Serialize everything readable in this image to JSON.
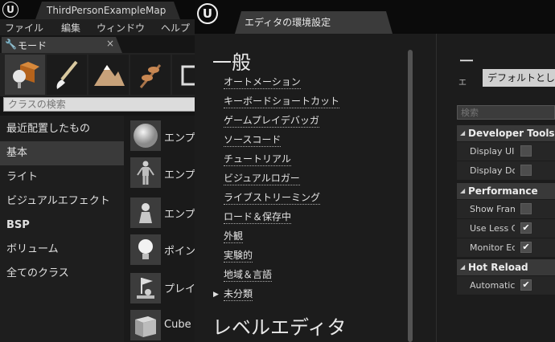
{
  "main_window": {
    "map_tab_title": "ThirdPersonExampleMap",
    "menu": [
      "ファイル",
      "編集",
      "ウィンドウ",
      "ヘルプ"
    ]
  },
  "modes_panel": {
    "tab_label": "モード",
    "close_symbol": "×",
    "mode_icons": [
      "place-mode-icon",
      "paint-mode-icon",
      "landscape-mode-icon",
      "foliage-mode-icon",
      "geometry-mode-icon"
    ],
    "search_placeholder": "クラスの検索",
    "categories": [
      "最近配置したもの",
      "基本",
      "ライト",
      "ビジュアルエフェクト",
      "BSP",
      "ボリューム",
      "全てのクラス"
    ],
    "selected_category": "基本",
    "assets": [
      "エンプ",
      "エンプ",
      "エンプ",
      "ポイン",
      "プレイ",
      "Cube"
    ]
  },
  "prefs_window": {
    "title": "エディタの環境設定",
    "general_header": "一般",
    "nav_links": [
      "オートメーション",
      "キーボードショートカット",
      "ゲームプレイデバッガ",
      "ソースコード",
      "チュートリアル",
      "ビジュアルロガー",
      "ライブストリーミング",
      "ロード＆保存中",
      "外観",
      "実験的",
      "地域＆言語",
      "未分類"
    ],
    "level_editor_header": "レベルエディタ",
    "details": {
      "heading": "ー",
      "preset_label": "エ",
      "preset_value": "デフォルトとし",
      "search_placeholder": "検索",
      "categories": [
        {
          "name": "Developer Tools",
          "props": [
            {
              "name": "Display UIE",
              "checked": false
            },
            {
              "name": "Display Doc",
              "checked": false
            }
          ]
        },
        {
          "name": "Performance",
          "props": [
            {
              "name": "Show Fram",
              "checked": false
            },
            {
              "name": "Use Less C",
              "checked": true
            },
            {
              "name": "Monitor Edi",
              "checked": true
            }
          ]
        },
        {
          "name": "Hot Reload",
          "props": [
            {
              "name": "Automatica",
              "checked": true
            }
          ]
        }
      ],
      "check_symbol": "✔"
    }
  },
  "colors": {
    "background": "#1c1c1c",
    "titlebar": "#0b0b0b",
    "selected_item": "#3a3a3a",
    "search_box": "#dcdcdc"
  }
}
